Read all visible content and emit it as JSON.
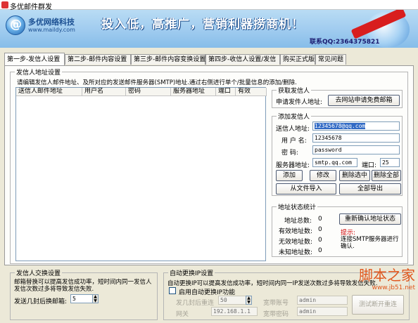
{
  "window": {
    "title": "多优邮件群发"
  },
  "banner": {
    "logo_name": "多优网络科技",
    "logo_url": "www.maildy.com",
    "slogan": "投入低，高推广，营销利器捞商机！",
    "contact": "联系QQ:2364375821"
  },
  "tabs": [
    {
      "label": "第一步-发信人设置"
    },
    {
      "label": "第二步-邮件内容设置"
    },
    {
      "label": "第三步-邮件内容变换设置"
    },
    {
      "label": "第四步-收信人设置/发信"
    },
    {
      "label": "购买正式版"
    },
    {
      "label": "常见问题"
    }
  ],
  "sender_addr_group": {
    "title": "发信人地址设置",
    "description": "请编辑发信人邮件地址、及所对应的发送邮件服务器(SMTP)地址.通过右侧进行单个/批量信息的添加/删除.",
    "columns": [
      "送信人邮件地址",
      "用户名",
      "密码",
      "服务器地址",
      "端口",
      "有效"
    ]
  },
  "get_sender": {
    "title": "获取发信人",
    "label": "申请发件人地址:",
    "button": "去网站申请免费邮箱"
  },
  "add_sender": {
    "title": "添加发信人",
    "address_label": "送信人地址:",
    "address_value": "12345678@qq.com",
    "username_label": "用 户 名:",
    "username_value": "12345678",
    "password_label": "密    码:",
    "password_value": "password",
    "server_label": "服务器地址:",
    "server_value": "smtp.qq.com",
    "port_label": "端口:",
    "port_value": "25",
    "btn_add": "添加",
    "btn_modify": "修改",
    "btn_delete_selected": "删除选中",
    "btn_delete_all": "删除全部",
    "btn_import": "从文件导入",
    "btn_export": "全部导出"
  },
  "addr_stats": {
    "title": "地址状态统计",
    "total_label": "地址总数:",
    "total_value": "0",
    "valid_label": "有效地址数:",
    "valid_value": "0",
    "invalid_label": "无效地址数:",
    "invalid_value": "0",
    "unknown_label": "未知地址数:",
    "unknown_value": "0",
    "recheck_button": "重新确认地址状态",
    "hint_title": "提示:",
    "hint_text": "连接SMTP服务器进行确认."
  },
  "rotate": {
    "title": "发信人交换设置",
    "description": "邮箱替换可以提高发信成功率，短时间内同一发信人发信次数过多将导致发信失败.",
    "count_label": "发送几封后换邮箱:",
    "count_value": "5"
  },
  "auto_ip": {
    "title": "自动更换IP设置",
    "description": "自动更换IP可以提高发信成功率，短时间内同一IP发送次数过多将导致发信失败.",
    "enable_label": "启用自动更换IP功能",
    "resend_label": "发几封后重连",
    "resend_value": "50",
    "broadband_account_label": "宽带账号",
    "broadband_account_value": "admin",
    "gateway_label": "网关",
    "gateway_value": "192.168.1.1",
    "broadband_password_label": "宽带密码",
    "broadband_password_value": "admin",
    "test_button": "测试断开重连"
  },
  "watermark": {
    "line1": "脚本之家",
    "line2": "www.jb51.net"
  }
}
